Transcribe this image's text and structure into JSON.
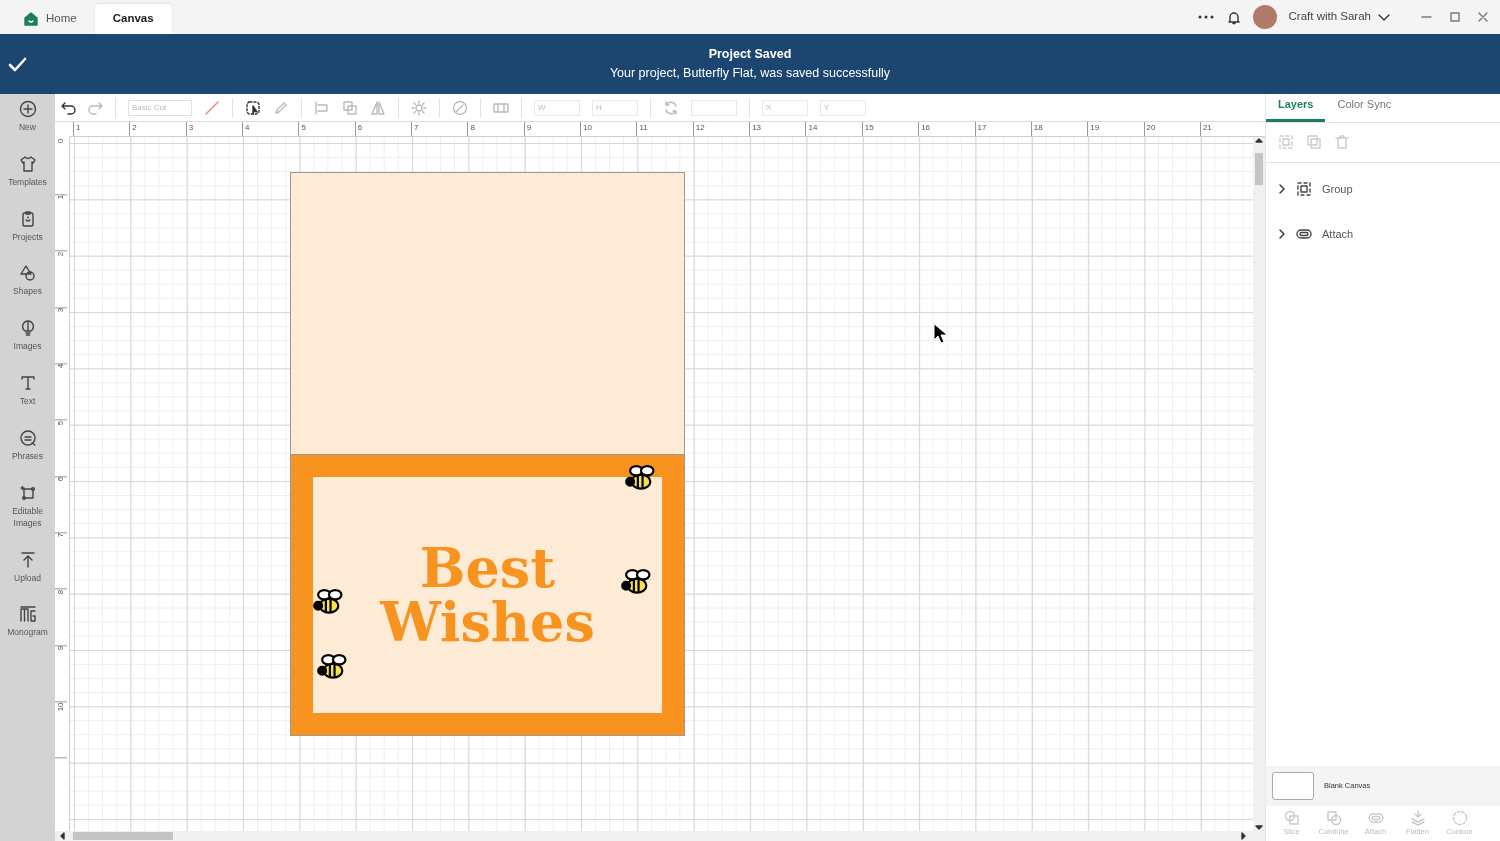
{
  "window": {
    "tabs": [
      {
        "label": "Home",
        "kind": "home",
        "selected": false
      },
      {
        "label": "Canvas",
        "kind": "plain",
        "selected": true
      }
    ],
    "account": {
      "name": "Craft with Sarah"
    }
  },
  "notification": {
    "title": "Project Saved",
    "message": "Your project, Butterfly Flat, was saved successfully"
  },
  "sidebar": {
    "items": [
      {
        "label": "New",
        "kind": "plus"
      },
      {
        "label": "Templates",
        "kind": "shirt"
      },
      {
        "label": "Projects",
        "kind": "clipboard"
      },
      {
        "label": "Shapes",
        "kind": "shapes"
      },
      {
        "label": "Images",
        "kind": "bulb"
      },
      {
        "label": "Text",
        "kind": "text"
      },
      {
        "label": "Phrases",
        "kind": "chat"
      },
      {
        "label": "Editable Images",
        "kind": "edit"
      },
      {
        "label": "Upload",
        "kind": "upload"
      },
      {
        "label": "Monogram",
        "kind": "monogram"
      }
    ]
  },
  "toolbar": {
    "operation": {
      "value": "Basic Cut"
    },
    "size_fields": [
      {
        "label": "W"
      },
      {
        "label": "H"
      }
    ],
    "position_fields": [
      {
        "label": "X"
      },
      {
        "label": "Y"
      }
    ]
  },
  "rulers": {
    "horizontal": [
      "1",
      "2",
      "3",
      "4",
      "5",
      "6",
      "7",
      "8",
      "9",
      "10",
      "11",
      "12",
      "13",
      "14",
      "15",
      "16",
      "17",
      "18",
      "19",
      "20",
      "21"
    ],
    "vertical": [
      "0",
      "1",
      "2",
      "3",
      "4",
      "5",
      "6",
      "7",
      "8",
      "9",
      "10"
    ]
  },
  "design": {
    "text": "Best Wishes"
  },
  "panel": {
    "tabs": [
      {
        "label": "Layers",
        "selected": true
      },
      {
        "label": "Color Sync",
        "selected": false
      }
    ],
    "layers": [
      {
        "label": "Group",
        "kind": "group",
        "expanded": false
      },
      {
        "label": "Attach",
        "kind": "attach",
        "expanded": false
      }
    ],
    "canvas_label": "Blank Canvas",
    "actions": [
      {
        "label": "Slice",
        "kind": "slice",
        "disabled": true
      },
      {
        "label": "Combine",
        "kind": "combine",
        "disabled": true
      },
      {
        "label": "Attach",
        "kind": "attach",
        "disabled": true
      },
      {
        "label": "Flatten",
        "kind": "flatten",
        "disabled": true
      },
      {
        "label": "Contour",
        "kind": "contour",
        "disabled": true
      }
    ]
  }
}
